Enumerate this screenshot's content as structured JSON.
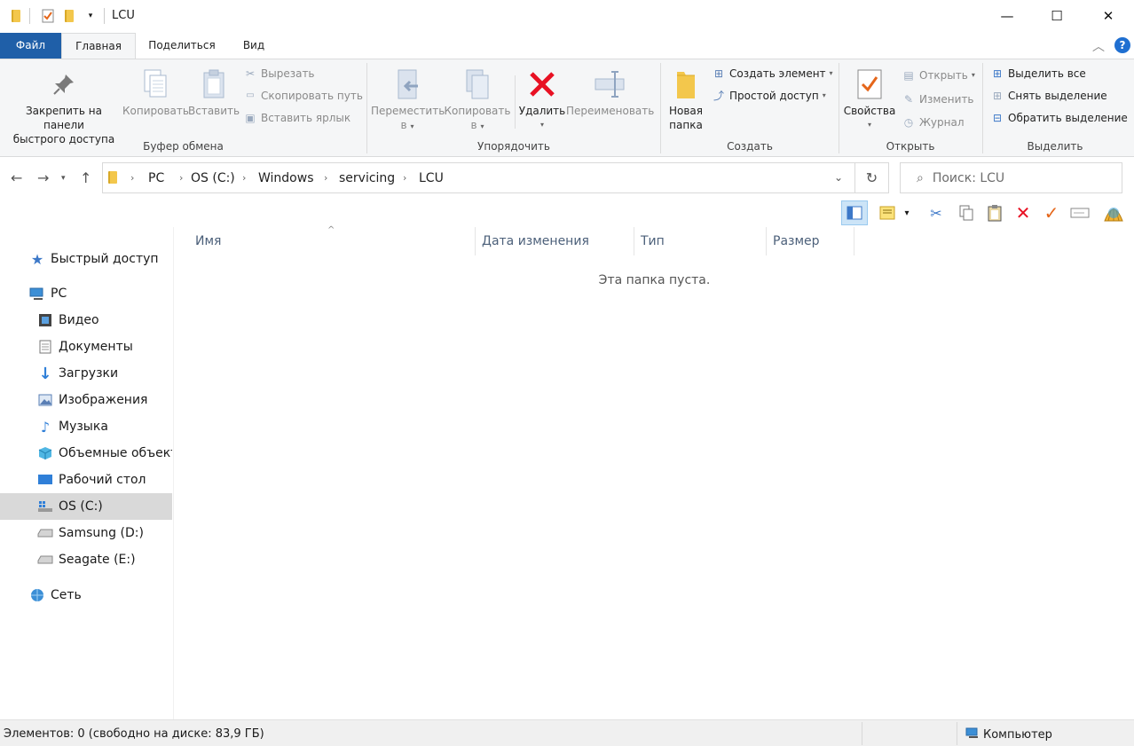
{
  "window": {
    "title": "LCU",
    "minimize_glyph": "—",
    "maximize_glyph": "☐",
    "close_glyph": "✕"
  },
  "tabs": [
    {
      "label": "Файл"
    },
    {
      "label": "Главная"
    },
    {
      "label": "Поделиться"
    },
    {
      "label": "Вид"
    }
  ],
  "ribbon": {
    "clipboard": {
      "label": "Буфер обмена",
      "pin_line1": "Закрепить на панели",
      "pin_line2": "быстрого доступа",
      "copy": "Копировать",
      "paste": "Вставить",
      "cut": "Вырезать",
      "copy_path": "Скопировать путь",
      "paste_shortcut": "Вставить ярлык"
    },
    "organize": {
      "label": "Упорядочить",
      "move_line1": "Переместить",
      "move_line2": "в",
      "copyto_line1": "Копировать",
      "copyto_line2": "в",
      "delete": "Удалить",
      "rename": "Переименовать"
    },
    "new": {
      "label": "Создать",
      "new_folder_line1": "Новая",
      "new_folder_line2": "папка",
      "new_item": "Создать элемент",
      "easy_access": "Простой доступ"
    },
    "open": {
      "label": "Открыть",
      "properties": "Свойства",
      "open": "Открыть",
      "edit": "Изменить",
      "history": "Журнал"
    },
    "select": {
      "label": "Выделить",
      "select_all": "Выделить все",
      "select_none": "Снять выделение",
      "invert": "Обратить выделение"
    }
  },
  "address": {
    "crumbs": [
      "PC",
      "OS (C:)",
      "Windows",
      "servicing",
      "LCU"
    ],
    "search_placeholder": "Поиск: LCU"
  },
  "nav": {
    "quick_access": "Быстрый доступ",
    "pc": "PC",
    "video": "Видео",
    "documents": "Документы",
    "downloads": "Загрузки",
    "pictures": "Изображения",
    "music": "Музыка",
    "objects3d": "Объемные объекты",
    "desktop": "Рабочий стол",
    "drive_c": "OS (C:)",
    "drive_d": "Samsung (D:)",
    "drive_e": "Seagate (E:)",
    "network": "Сеть"
  },
  "columns": {
    "name": "Имя",
    "date": "Дата изменения",
    "type": "Тип",
    "size": "Размер"
  },
  "content": {
    "empty_message": "Эта папка пуста."
  },
  "status": {
    "items": "Элементов: 0 (свободно на диске: 83,9 ГБ)",
    "computer": "Компьютер"
  },
  "colors": {
    "file_tab": "#1f5fa8",
    "selected_nav": "#d9d9d9",
    "delete_red": "#e81123"
  }
}
